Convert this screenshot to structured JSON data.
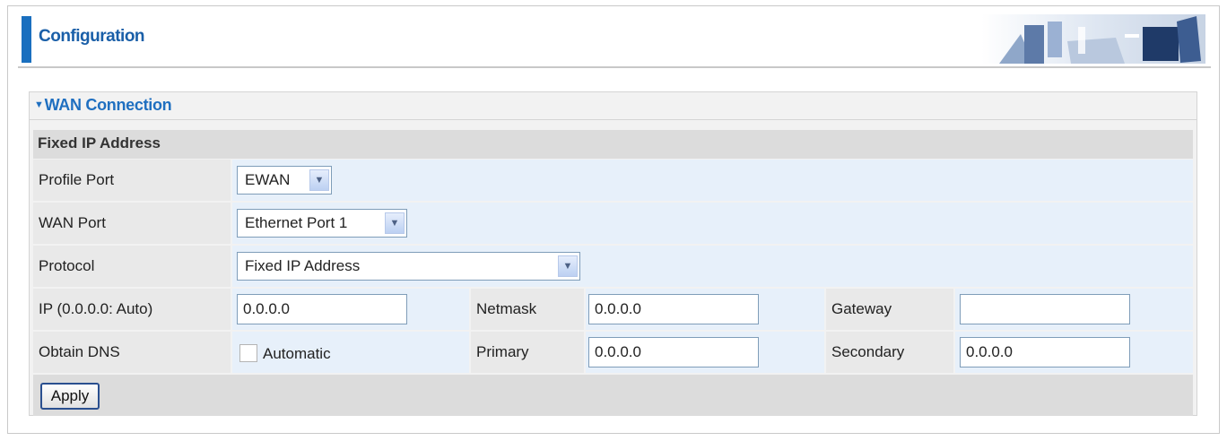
{
  "header": {
    "title": "Configuration"
  },
  "panel": {
    "title": "WAN Connection",
    "section": "Fixed IP Address",
    "fields": {
      "profile_port": {
        "label": "Profile Port",
        "value": "EWAN"
      },
      "wan_port": {
        "label": "WAN Port",
        "value": "Ethernet Port 1"
      },
      "protocol": {
        "label": "Protocol",
        "value": "Fixed IP Address"
      },
      "ip": {
        "label": "IP (0.0.0.0: Auto)",
        "value": "0.0.0.0"
      },
      "netmask": {
        "label": "Netmask",
        "value": "0.0.0.0"
      },
      "gateway": {
        "label": "Gateway",
        "value": ""
      },
      "obtain_dns": {
        "label": "Obtain DNS",
        "checkbox_label": "Automatic",
        "checked": false
      },
      "primary": {
        "label": "Primary",
        "value": "0.0.0.0"
      },
      "secondary": {
        "label": "Secondary",
        "value": "0.0.0.0"
      }
    },
    "apply_label": "Apply"
  },
  "colors": {
    "accent": "#1a6fbf",
    "title": "#1f6fc0",
    "row_light": "#e7f0fa",
    "row_gray": "#e9e9e9"
  }
}
